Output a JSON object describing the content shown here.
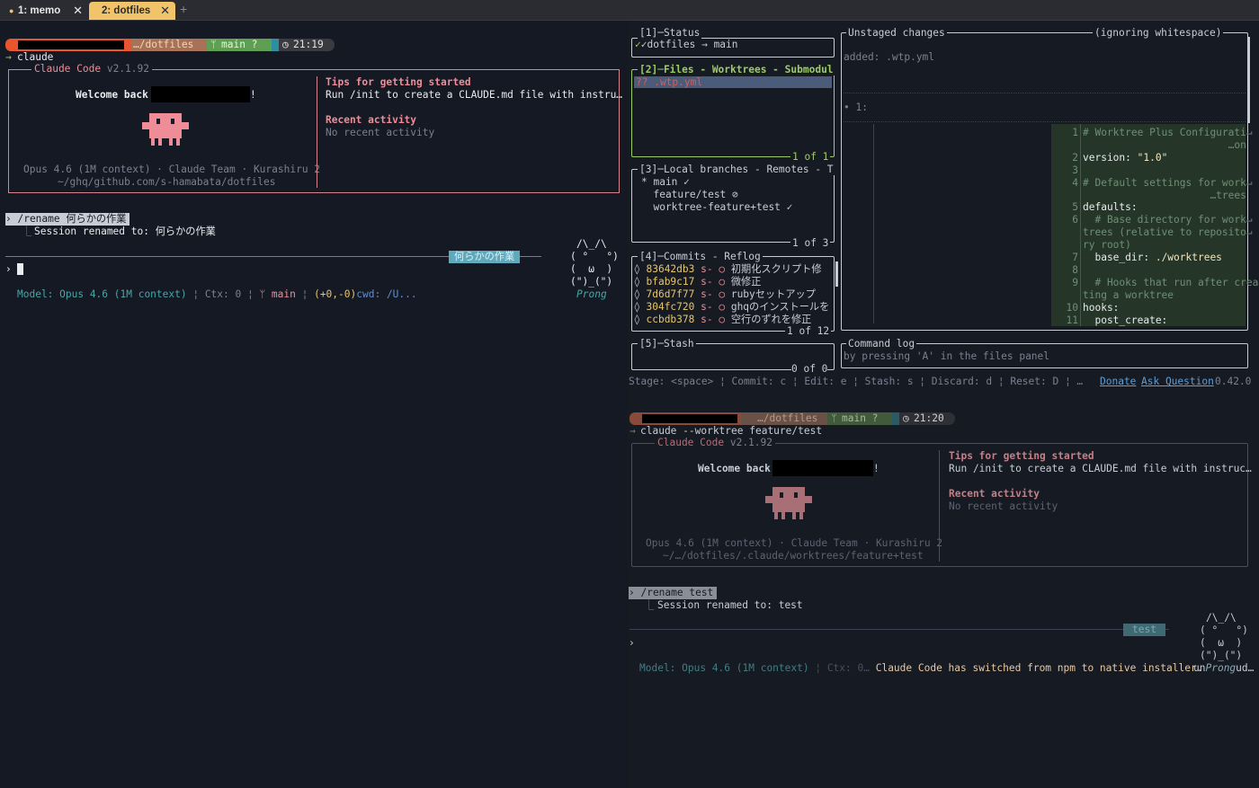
{
  "tabs": [
    {
      "label": "1: memo"
    },
    {
      "label": "2: dotfiles"
    }
  ],
  "icons": {
    "close": "close-icon",
    "add": "plus-icon",
    "apple": "apple-icon",
    "branch": "branch-icon",
    "clock": "clock-icon"
  },
  "left": {
    "prompt": {
      "dir": "…/dotfiles",
      "branch": "main ?",
      "time": "21:19",
      "command": "claude"
    },
    "cc": {
      "title": "Claude Code",
      "version": "v2.1.92",
      "welcome": "Welcome back",
      "bang": "!",
      "model_line": "Opus 4.6 (1M context) · Claude Team · Kurashiru 2",
      "path": "~/ghq/github.com/s-hamabata/dotfiles",
      "tips_title": "Tips for getting started",
      "tips_text": "Run /init to create a CLAUDE.md file with instru…",
      "recent_title": "Recent activity",
      "recent_text": "No recent activity"
    },
    "rename_cmd": "› /rename 何らかの作業",
    "rename_result": "Session renamed to: 何らかの作業",
    "session_tag": "何らかの作業",
    "cat": [
      "/\\_/\\",
      "( °   °)",
      "(  ω  )",
      "(\")_(\")"
    ],
    "cat_name": "Prong",
    "input_prompt": "›",
    "status": {
      "model": "Model: Opus 4.6 (1M context)",
      "ctx": "Ctx: 0",
      "branch": "main",
      "diff": "(+0,-0)",
      "cwd_label": "cwd:",
      "cwd": "/U..."
    }
  },
  "lazygit": {
    "status_title": "[1]─Status",
    "status_text": "✓dotfiles → main",
    "files_title": "[2]─Files - Worktrees - Submodul",
    "file_item": "?? .wtp.yml",
    "files_count": "1 of 1",
    "branches_title": "[3]─Local branches - Remotes - T",
    "branches": [
      "* main ✓",
      "  feature/test ⊘",
      "  worktree-feature+test ✓"
    ],
    "branches_count": "1 of 3",
    "commits_title": "[4]─Commits - Reflog",
    "commits": [
      {
        "hash": "83642db3",
        "author": "s-",
        "msg": "初期化スクリプト修"
      },
      {
        "hash": "bfab9c17",
        "author": "s-",
        "msg": "微修正"
      },
      {
        "hash": "7d6d7f77",
        "author": "s-",
        "msg": "rubyセットアップ"
      },
      {
        "hash": "304fc720",
        "author": "s-",
        "msg": "ghqのインストールを"
      },
      {
        "hash": "ccbdb378",
        "author": "s-",
        "msg": "空行のずれを修正"
      }
    ],
    "commits_count": "1 of 12",
    "stash_title": "[5]─Stash",
    "stash_count": "0 of 0",
    "unstaged_title": "Unstaged changes",
    "whitespace": "(ignoring whitespace)",
    "added": "added: .wtp.yml",
    "hunk": "• 1:",
    "code": [
      {
        "n": "1",
        "t": "# Worktree Plus Configurati↵",
        "c": "comment"
      },
      {
        "n": "",
        "t": "                        …on",
        "c": "comment"
      },
      {
        "n": "2",
        "t": "version: \"1.0\"",
        "c": "kv"
      },
      {
        "n": "3",
        "t": "",
        "c": "plain"
      },
      {
        "n": "4",
        "t": "# Default settings for work↵",
        "c": "comment"
      },
      {
        "n": "",
        "t": "                     …trees",
        "c": "comment"
      },
      {
        "n": "5",
        "t": "defaults:",
        "c": "key"
      },
      {
        "n": "6",
        "t": "  # Base directory for work↵",
        "c": "comment"
      },
      {
        "n": "",
        "t": "trees (relative to reposito↵",
        "c": "comment"
      },
      {
        "n": "",
        "t": "ry root)",
        "c": "comment"
      },
      {
        "n": "7",
        "t": "  base_dir: ./worktrees",
        "c": "kv"
      },
      {
        "n": "8",
        "t": "",
        "c": "plain"
      },
      {
        "n": "9",
        "t": "  # Hooks that run after crea↵",
        "c": "comment"
      },
      {
        "n": "",
        "t": "ting a worktree",
        "c": "comment"
      },
      {
        "n": "10",
        "t": "hooks:",
        "c": "key"
      },
      {
        "n": "11",
        "t": "  post_create:",
        "c": "key"
      }
    ],
    "cmdlog_title": "Command log",
    "cmdlog_text": "by pressing 'A' in the files panel",
    "footer": "Stage: <space> ¦ Commit: c ¦ Edit: e ¦ Stash: s ¦ Discard: d ¦ Reset: D ¦ …",
    "donate": "Donate",
    "ask": "Ask Question",
    "version": "0.42.0"
  },
  "right": {
    "prompt": {
      "dir": "…/dotfiles",
      "branch": "main ?",
      "time": "21:20",
      "command": "claude --worktree feature/test"
    },
    "cc": {
      "title": "Claude Code",
      "version": "v2.1.92",
      "welcome": "Welcome back",
      "bang": "!",
      "model_line": "Opus 4.6 (1M context) · Claude Team · Kurashiru 2",
      "path": "~/…/dotfiles/.claude/worktrees/feature+test",
      "tips_title": "Tips for getting started",
      "tips_text": "Run /init to create a CLAUDE.md file with instruc…",
      "recent_title": "Recent activity",
      "recent_text": "No recent activity"
    },
    "rename_cmd": "› /rename test",
    "rename_result": "Session renamed to: test",
    "session_tag": "test",
    "cat": [
      "/\\_/\\",
      "( °   °)",
      "(  ω  )",
      "(\")_(\")"
    ],
    "cat_name": "Prong",
    "cat_prefix": "un",
    "cat_suffix": "ud…",
    "input_prompt": "›",
    "status": {
      "model": "Model: Opus 4.6 (1M context)",
      "ctx": "Ctx: 0…",
      "notice": "Claude Code has switched from npm to native installer."
    }
  },
  "colors": {
    "accent": "#ee8d97",
    "teal": "#46a7a7",
    "green": "#9ccc65",
    "yellow_tab": "#f2c46a"
  }
}
